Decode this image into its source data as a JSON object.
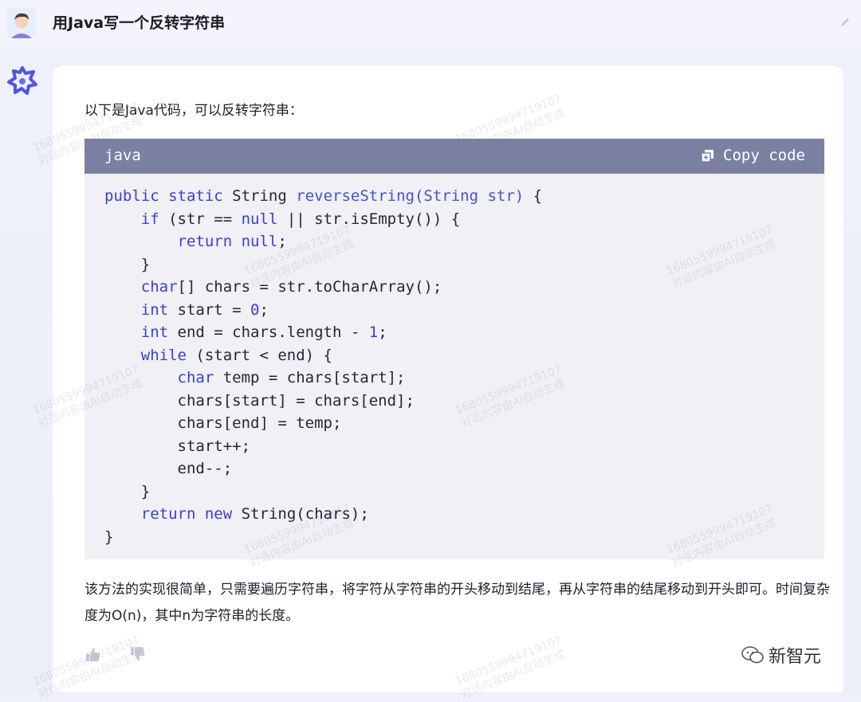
{
  "question": {
    "text": "用Java写一个反转字符串"
  },
  "answer": {
    "intro": "以下是Java代码，可以反转字符串：",
    "code_block": {
      "language": "java",
      "copy_label": "Copy code"
    },
    "explanation": "该方法的实现很简单，只需要遍历字符串，将字符从字符串的开头移动到结尾，再从字符串的结尾移动到开头即可。时间复杂度为O(n)，其中n为字符串的长度。"
  },
  "watermark": {
    "line1": "1680559994719107",
    "line2": "对话内容由AI自动生成"
  },
  "brand": {
    "name": "新智元"
  },
  "icons": {
    "avatar": "user-avatar",
    "edit": "pencil-icon",
    "bot": "bot-logo-icon",
    "copy": "copy-icon",
    "like": "thumbs-up-icon",
    "dislike": "thumbs-down-icon"
  },
  "colors": {
    "code_header_bg": "#7b80a3",
    "code_body_bg": "#f0f0f5",
    "keyword": "#3b3fcf",
    "page_bg": "#eef0fb"
  }
}
